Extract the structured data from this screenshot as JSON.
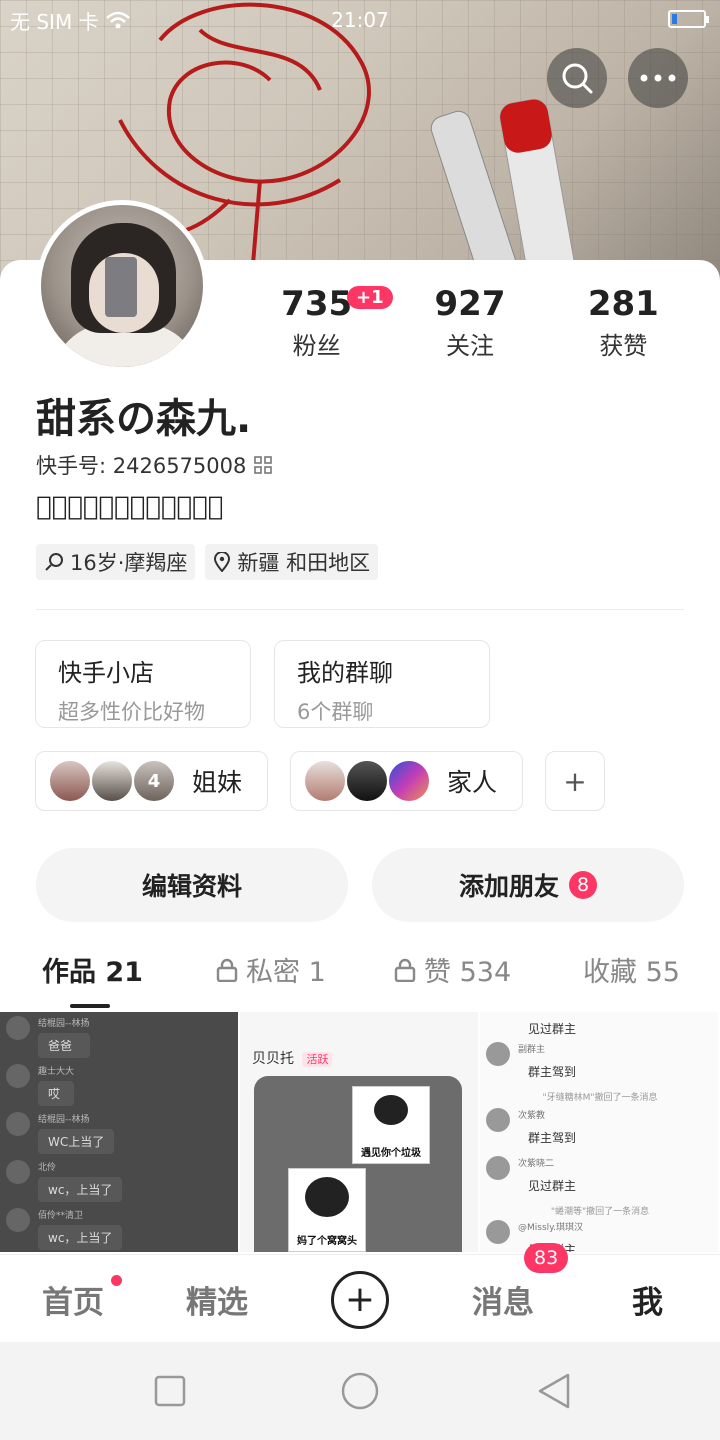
{
  "status_bar": {
    "carrier": "无 SIM 卡",
    "time": "21:07"
  },
  "header": {
    "search_icon": "search-icon",
    "more_icon": "more-icon"
  },
  "profile": {
    "stats": [
      {
        "value": "735",
        "label": "粉丝",
        "badge": "+1"
      },
      {
        "value": "927",
        "label": "关注"
      },
      {
        "value": "281",
        "label": "获赞"
      }
    ],
    "name": "甜系の森九.",
    "kuaishou_id_label": "快手号: 2426575008",
    "signature": "ꦿ᷂ꦿ᷂ꦿ᷂ꦿ᷂ꦿ᷂ꦿ᷂",
    "tags": [
      {
        "icon": "search-icon",
        "text": "16岁·摩羯座"
      },
      {
        "icon": "location-icon",
        "text": "新疆 和田地区"
      }
    ]
  },
  "entries": [
    {
      "title": "快手小店",
      "subtitle": "超多性价比好物"
    },
    {
      "title": "我的群聊",
      "subtitle": "6个群聊"
    }
  ],
  "groups": [
    {
      "label": "姐妹",
      "extra_count": "4"
    },
    {
      "label": "家人"
    }
  ],
  "actions": {
    "edit_profile": "编辑资料",
    "add_friends": "添加朋友",
    "add_friends_badge": "8"
  },
  "tabs": [
    {
      "label": "作品 21",
      "active": true
    },
    {
      "label": "私密 1",
      "locked": true
    },
    {
      "label": "赞 534",
      "locked": true
    },
    {
      "label": "收藏 55"
    }
  ],
  "thumbs": {
    "cell1": [
      {
        "name": "结棍园--林扬",
        "msg": "爸爸"
      },
      {
        "name": "趣士大大",
        "msg": "哎"
      },
      {
        "name": "结棍园--林扬",
        "msg": "WC上当了"
      },
      {
        "name": "北伶",
        "msg": "wc，上当了"
      },
      {
        "name": "佰伶**清卫",
        "msg": "wc，上当了"
      }
    ],
    "cell2": {
      "name": "贝贝托",
      "tag": "活跃",
      "sticker1": "遇见你个垃圾",
      "sticker2": "妈了个窝窝头"
    },
    "cell3": [
      {
        "msg": "见过群主"
      },
      {
        "name": "副群主",
        "msg": "群主驾到"
      },
      {
        "sys": "\"牙缝糖林M\"撤回了一条消息"
      },
      {
        "name": "次紫教",
        "msg": "群主驾到"
      },
      {
        "name": "次紫晓二",
        "msg": "见过群主"
      },
      {
        "sys": "\"蜷潮等\"撤回了一条消息"
      },
      {
        "name": "@Missly.琪琪汉",
        "msg": "见过群主"
      }
    ]
  },
  "bottom_nav": [
    {
      "label": "首页",
      "dot": true
    },
    {
      "label": "精选"
    },
    {
      "label": "+"
    },
    {
      "label": "消息",
      "badge": "83"
    },
    {
      "label": "我",
      "active": true
    }
  ],
  "colors": {
    "accent": "#fe3666",
    "text": "#222222",
    "muted": "#999999"
  }
}
